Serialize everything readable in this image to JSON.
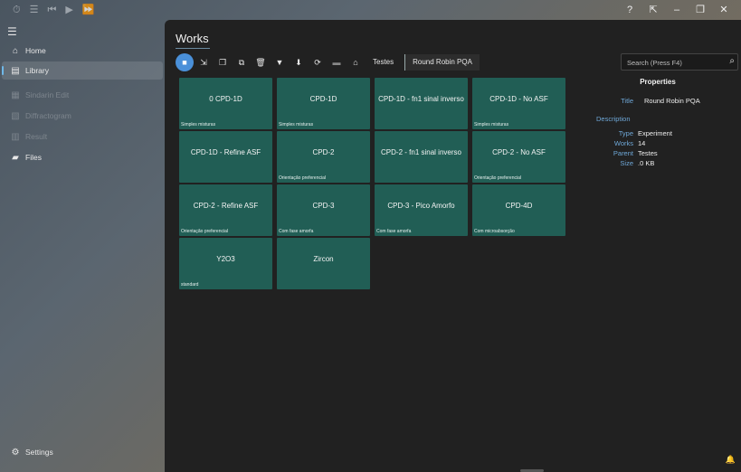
{
  "window": {
    "playback_icons": [
      "hamburger-icon",
      "timer-icon",
      "playlist-icon",
      "skip-back-icon",
      "play-icon",
      "fast-forward-icon"
    ],
    "controls": {
      "help": "?",
      "compact": "⇱",
      "minimize": "–",
      "maximize": "❐",
      "close": "✕"
    }
  },
  "sidebar": {
    "items": [
      {
        "label": "Home",
        "icon": "home-icon",
        "glyph": "⌂",
        "state": "normal"
      },
      {
        "label": "Library",
        "icon": "library-icon",
        "glyph": "▤",
        "state": "active"
      },
      {
        "label": "Sindarin Edit",
        "icon": "edit-icon",
        "glyph": "▦",
        "state": "disabled"
      },
      {
        "label": "Diffractogram",
        "icon": "chart-icon",
        "glyph": "▧",
        "state": "disabled"
      },
      {
        "label": "Result",
        "icon": "result-icon",
        "glyph": "▥",
        "state": "disabled"
      },
      {
        "label": "Files",
        "icon": "folder-icon",
        "glyph": "▰",
        "state": "normal"
      }
    ],
    "settings_label": "Settings"
  },
  "main": {
    "title": "Works",
    "breadcrumbs": [
      "Testes",
      "Round Robin PQA"
    ],
    "search_placeholder": "Search (Press F4)"
  },
  "tiles": [
    {
      "title": "0 CPD-1D",
      "subtitle": "Simples misturas"
    },
    {
      "title": "CPD-1D",
      "subtitle": "Simples misturas"
    },
    {
      "title": "CPD-1D - fn1 sinal inverso",
      "subtitle": ""
    },
    {
      "title": "CPD-1D - No ASF",
      "subtitle": "Simples misturas"
    },
    {
      "title": "CPD-1D - Refine ASF",
      "subtitle": ""
    },
    {
      "title": "CPD-2",
      "subtitle": "Orientação preferencial"
    },
    {
      "title": "CPD-2 - fn1 sinal inverso",
      "subtitle": ""
    },
    {
      "title": "CPD-2 - No ASF",
      "subtitle": "Orientação preferencial"
    },
    {
      "title": "CPD-2 - Refine ASF",
      "subtitle": "Orientação preferencial"
    },
    {
      "title": "CPD-3",
      "subtitle": "Com fase amorfa"
    },
    {
      "title": "CPD-3 - Pico Amorfo",
      "subtitle": "Com fase amorfa"
    },
    {
      "title": "CPD-4D",
      "subtitle": "Com microabsorção"
    },
    {
      "title": "Y2O3",
      "subtitle": "standard"
    },
    {
      "title": "Zircon",
      "subtitle": ""
    }
  ],
  "properties": {
    "heading": "Properties",
    "title_key": "Title",
    "title_value": "Round Robin PQA",
    "description_key": "Description",
    "type_key": "Type",
    "type_value": "Experiment",
    "works_key": "Works",
    "works_value": "14",
    "parent_key": "Parent",
    "parent_value": "Testes",
    "size_key": "Size",
    "size_value": ".0 KB"
  },
  "colors": {
    "tile": "#215e55",
    "accent": "#4a90d9",
    "key": "#6fa8d8",
    "panel": "#212121"
  }
}
